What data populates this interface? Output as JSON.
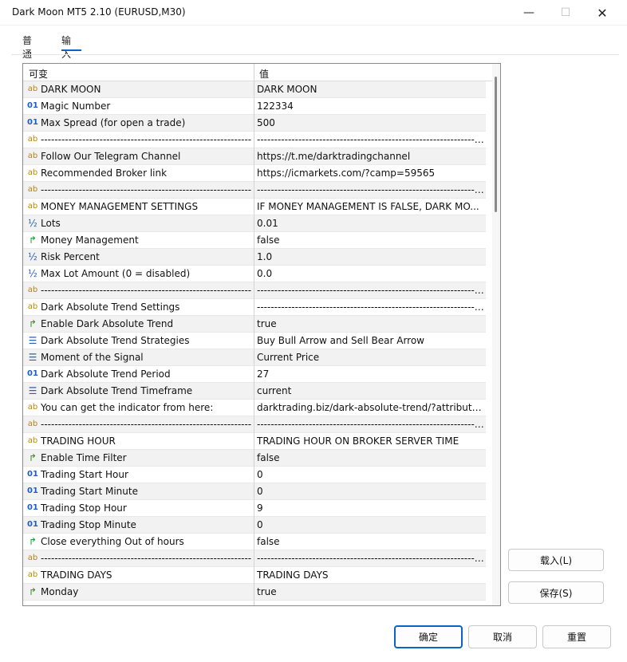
{
  "window": {
    "title": "Dark Moon MT5 2.10 (EURUSD,M30)",
    "minimize": "—",
    "maximize": "☐",
    "close": "✕"
  },
  "tabs": {
    "general": "普通",
    "inputs": "输入"
  },
  "grid": {
    "col_variable": "可变",
    "col_value": "值",
    "rows": [
      {
        "icon": "ab",
        "name": "DARK MOON",
        "value": "DARK MOON"
      },
      {
        "icon": "01",
        "name": "Magic Number",
        "value": "122334"
      },
      {
        "icon": "01",
        "name": "Max Spread (for open a trade)",
        "value": "500"
      },
      {
        "icon": "ab",
        "name": "----------------------------------------------------------------------",
        "value": "----------------------------------------------------------------------..."
      },
      {
        "icon": "ab",
        "name": "Follow Our Telegram Channel",
        "value": "https://t.me/darktradingchannel"
      },
      {
        "icon": "ab",
        "name": "Recommended Broker link",
        "value": "https://icmarkets.com/?camp=59565"
      },
      {
        "icon": "ab",
        "name": "----------------------------------------------------------------------",
        "value": "----------------------------------------------------------------------..."
      },
      {
        "icon": "ab",
        "name": "MONEY MANAGEMENT SETTINGS",
        "value": "IF MONEY MANAGEMENT IS FALSE, DARK MO..."
      },
      {
        "icon": "½",
        "name": "Lots",
        "value": "0.01"
      },
      {
        "icon": "bool",
        "name": "Money Management",
        "value": "false"
      },
      {
        "icon": "½",
        "name": "Risk Percent",
        "value": "1.0"
      },
      {
        "icon": "½",
        "name": "Max Lot Amount (0 = disabled)",
        "value": "0.0"
      },
      {
        "icon": "ab",
        "name": "----------------------------------------------------------------------",
        "value": "----------------------------------------------------------------------..."
      },
      {
        "icon": "ab",
        "name": "Dark Absolute Trend Settings",
        "value": "----------------------------------------------------------------------"
      },
      {
        "icon": "bool",
        "name": "Enable Dark Absolute Trend",
        "value": "true"
      },
      {
        "icon": "enum",
        "name": "Dark Absolute Trend Strategies",
        "value": "Buy Bull Arrow and Sell Bear Arrow"
      },
      {
        "icon": "enum",
        "name": "Moment of the Signal",
        "value": "Current Price"
      },
      {
        "icon": "01",
        "name": "Dark Absolute Trend Period",
        "value": "27"
      },
      {
        "icon": "enum",
        "name": "Dark Absolute Trend Timeframe",
        "value": "current"
      },
      {
        "icon": "ab",
        "name": "You can get the indicator from here:",
        "value": "darktrading.biz/dark-absolute-trend/?attribute..."
      },
      {
        "icon": "ab",
        "name": "----------------------------------------------------------------------",
        "value": "----------------------------------------------------------------------..."
      },
      {
        "icon": "ab",
        "name": "TRADING HOUR",
        "value": "TRADING HOUR ON BROKER SERVER TIME"
      },
      {
        "icon": "bool",
        "name": "Enable Time Filter",
        "value": "false"
      },
      {
        "icon": "01",
        "name": "Trading Start Hour",
        "value": "0"
      },
      {
        "icon": "01",
        "name": "Trading Start Minute",
        "value": "0"
      },
      {
        "icon": "01",
        "name": "Trading Stop Hour",
        "value": "9"
      },
      {
        "icon": "01",
        "name": "Trading Stop Minute",
        "value": "0"
      },
      {
        "icon": "bool",
        "name": "Close everything Out of hours",
        "value": "false"
      },
      {
        "icon": "ab",
        "name": "----------------------------------------------------------------------",
        "value": "----------------------------------------------------------------------..."
      },
      {
        "icon": "ab",
        "name": "TRADING DAYS",
        "value": "TRADING DAYS"
      },
      {
        "icon": "bool",
        "name": "Monday",
        "value": "true"
      }
    ]
  },
  "buttons": {
    "load": "载入(L)",
    "save": "保存(S)",
    "ok": "确定",
    "cancel": "取消",
    "reset": "重置"
  },
  "colors": {
    "accent": "#0a64c8",
    "string_icon": "#b8860b",
    "int_icon": "#1f5fbf",
    "bool_icon": "#1c9a2c"
  }
}
